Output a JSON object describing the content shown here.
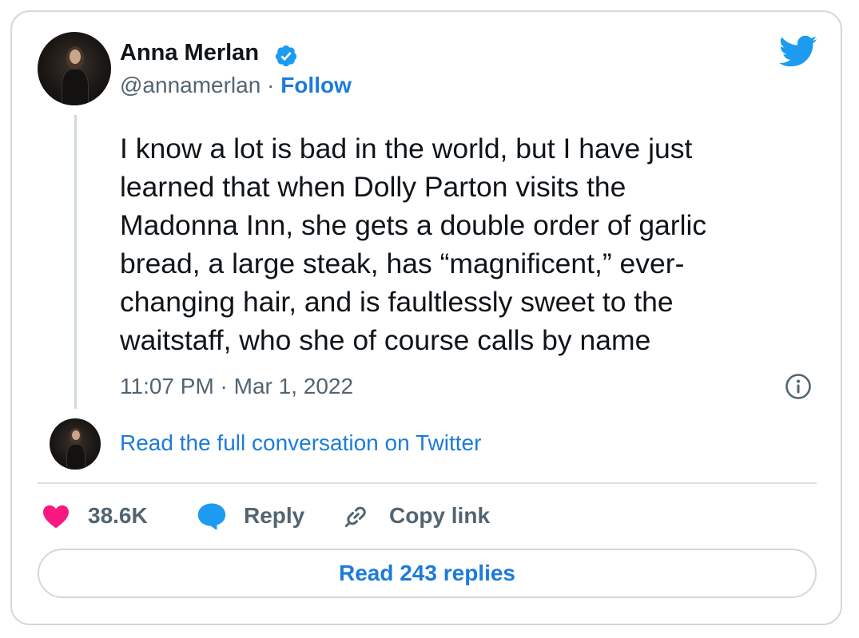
{
  "author": {
    "name": "Anna Merlan",
    "handle": "@annamerlan",
    "separator": " · ",
    "follow_label": "Follow"
  },
  "tweet": {
    "text": "I know a lot is bad in the world, but I have just\nlearned that when Dolly Parton visits the\nMadonna Inn, she gets a double order of garlic\nbread, a large steak, has “magnificent,” ever-\nchanging hair, and is faultlessly sweet to the\nwaitstaff, who she of course calls by name",
    "timestamp": "11:07 PM · Mar 1, 2022"
  },
  "conversation": {
    "link_label": "Read the full conversation on Twitter"
  },
  "actions": {
    "like_count": "38.6K",
    "reply_label": "Reply",
    "copy_label": "Copy link"
  },
  "footer": {
    "read_replies_label": "Read 243 replies"
  },
  "icons": {
    "verified": "verified-badge-icon",
    "brand": "twitter-bird-icon",
    "info": "info-icon",
    "like": "heart-icon",
    "reply": "speech-bubble-icon",
    "copy": "link-icon"
  },
  "colors": {
    "accent": "#1d9bf0",
    "link": "#1d7bd8",
    "like": "#f91880",
    "muted": "#536471",
    "border": "#cfd9de"
  }
}
